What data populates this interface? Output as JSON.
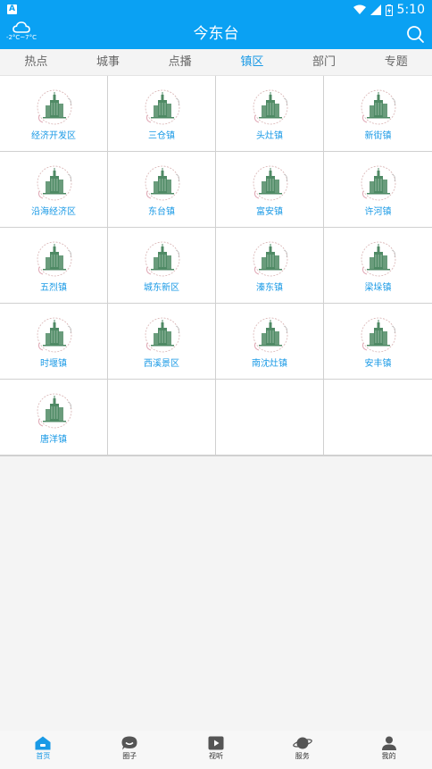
{
  "status_bar": {
    "notification_badge": "A",
    "time": "5:10"
  },
  "header": {
    "title": "今东台",
    "weather": {
      "temperature": "-2°C~7°C",
      "icon": "cloud-icon"
    }
  },
  "tabs": [
    {
      "label": "热点",
      "active": false
    },
    {
      "label": "城事",
      "active": false
    },
    {
      "label": "点播",
      "active": false
    },
    {
      "label": "镇区",
      "active": true
    },
    {
      "label": "部门",
      "active": false
    },
    {
      "label": "专题",
      "active": false
    }
  ],
  "grid": {
    "items": [
      {
        "name": "经济开发区"
      },
      {
        "name": "三仓镇"
      },
      {
        "name": "头灶镇"
      },
      {
        "name": "新街镇"
      },
      {
        "name": "沿海经济区"
      },
      {
        "name": "东台镇"
      },
      {
        "name": "富安镇"
      },
      {
        "name": "许河镇"
      },
      {
        "name": "五烈镇"
      },
      {
        "name": "城东新区"
      },
      {
        "name": "溱东镇"
      },
      {
        "name": "梁垛镇"
      },
      {
        "name": "时堰镇"
      },
      {
        "name": "西溪景区"
      },
      {
        "name": "南沈灶镇"
      },
      {
        "name": "安丰镇"
      },
      {
        "name": "唐洋镇"
      }
    ]
  },
  "bottom_nav": [
    {
      "label": "首页",
      "icon": "home-icon",
      "active": true
    },
    {
      "label": "圈子",
      "icon": "chat-bubble-icon",
      "active": false
    },
    {
      "label": "视听",
      "icon": "play-icon",
      "active": false
    },
    {
      "label": "服务",
      "icon": "planet-icon",
      "active": false
    },
    {
      "label": "我的",
      "icon": "user-icon",
      "active": false
    }
  ],
  "colors": {
    "primary": "#0aa1f3",
    "accent_text": "#1a9ae6",
    "building": "#4f8a65"
  }
}
